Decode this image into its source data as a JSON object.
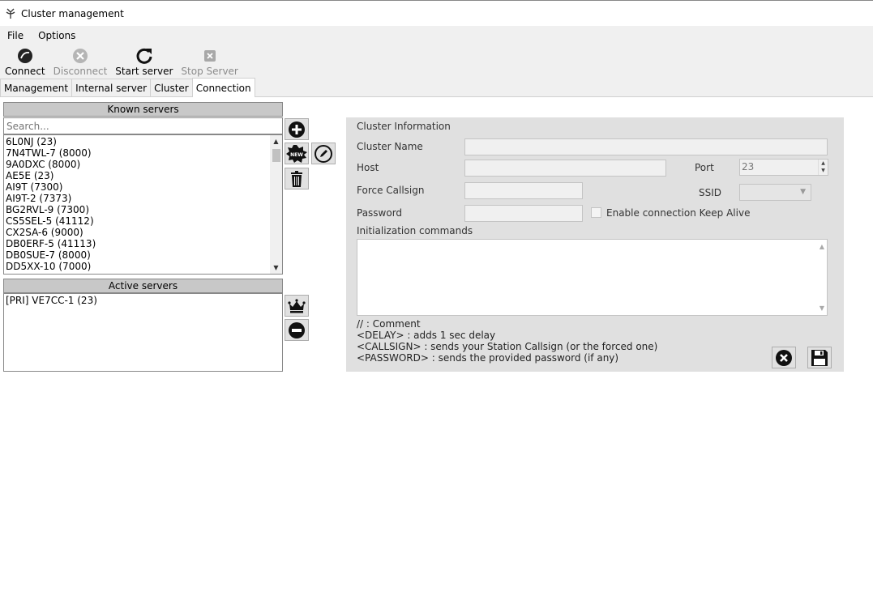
{
  "window": {
    "title": "Cluster management",
    "icon": "antenna-icon"
  },
  "menu": [
    {
      "label": "File"
    },
    {
      "label": "Options"
    }
  ],
  "toolbar": {
    "connect": "Connect",
    "disconnect": "Disconnect",
    "start_server": "Start server",
    "stop_server": "Stop Server"
  },
  "tabs": [
    {
      "label": "Management"
    },
    {
      "label": "Internal server"
    },
    {
      "label": "Cluster"
    },
    {
      "label": "Connection"
    }
  ],
  "known_servers": {
    "header": "Known servers",
    "search_placeholder": "Search...",
    "items": [
      "6L0NJ (23)",
      "7N4TWL-7 (8000)",
      "9A0DXC (8000)",
      "AE5E (23)",
      "AI9T (7300)",
      "AI9T-2 (7373)",
      "BG2RVL-9 (7300)",
      "CS5SEL-5 (41112)",
      "CX2SA-6 (9000)",
      "DB0ERF-5 (41113)",
      "DB0SUE-7 (8000)",
      "DD5XX-10 (7000)"
    ]
  },
  "active_servers": {
    "header": "Active servers",
    "items": [
      "[PRI] VE7CC-1 (23)"
    ]
  },
  "cluster_info": {
    "title": "Cluster Information",
    "cluster_name_label": "Cluster Name",
    "host_label": "Host",
    "port_label": "Port",
    "port_value": "23",
    "force_callsign_label": "Force Callsign",
    "ssid_label": "SSID",
    "password_label": "Password",
    "keep_alive_label": "Enable connection Keep Alive",
    "init_commands_label": "Initialization commands",
    "help_lines": [
      "// : Comment",
      "<DELAY> : adds 1 sec delay",
      "<CALLSIGN> : sends your Station Callsign (or the forced one)",
      "<PASSWORD> : sends the provided password (if any)"
    ]
  }
}
